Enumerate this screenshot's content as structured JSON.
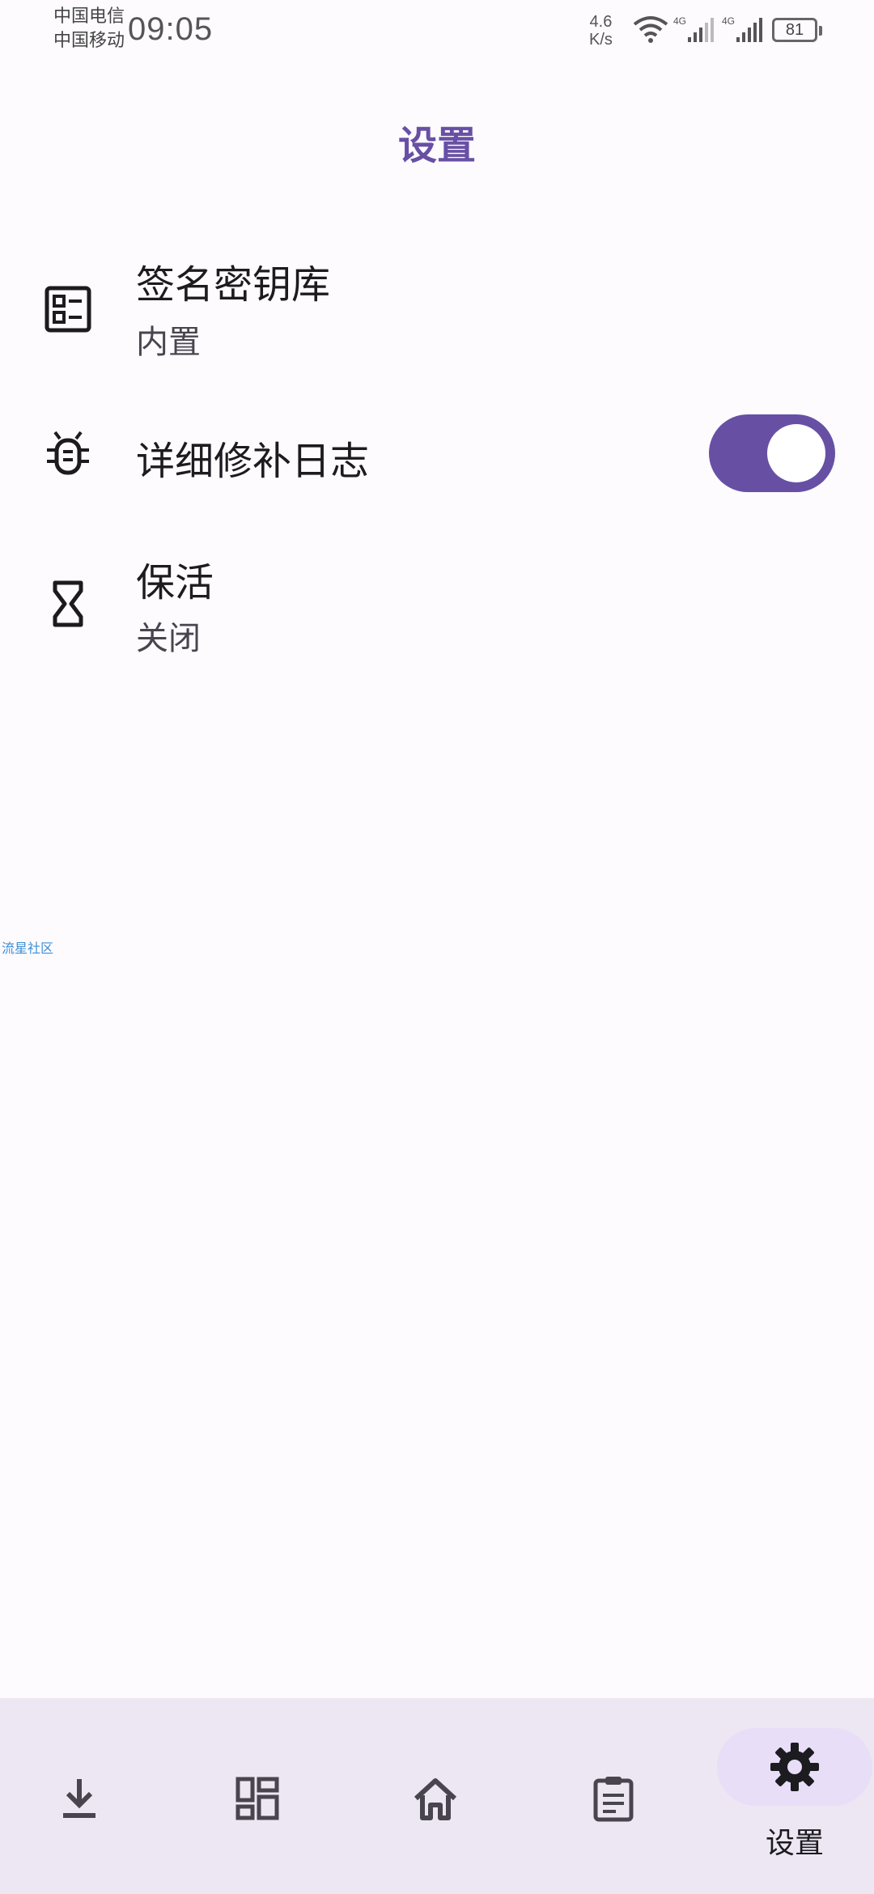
{
  "status_bar": {
    "carrier_1": "中国电信",
    "carrier_2": "中国移动",
    "time": "09:05",
    "speed_value": "4.6",
    "speed_unit": "K/s",
    "network_1": "4G",
    "network_2": "4G",
    "battery": "81"
  },
  "header": {
    "title": "设置"
  },
  "settings": [
    {
      "icon": "keystore-icon",
      "title": "签名密钥库",
      "subtitle": "内置"
    },
    {
      "icon": "bug-icon",
      "title": "详细修补日志",
      "toggle_on": true
    },
    {
      "icon": "hourglass-icon",
      "title": "保活",
      "subtitle": "关闭"
    }
  ],
  "watermark": "流星社区",
  "bottom_nav": {
    "items": [
      {
        "icon": "download-icon"
      },
      {
        "icon": "dashboard-icon"
      },
      {
        "icon": "home-icon"
      },
      {
        "icon": "clipboard-icon"
      },
      {
        "icon": "gear-icon",
        "label": "设置",
        "selected": true
      }
    ]
  },
  "colors": {
    "accent": "#6750a4",
    "background": "#fefbff",
    "nav_background": "#ede7f3",
    "nav_pill": "#e8def8"
  }
}
